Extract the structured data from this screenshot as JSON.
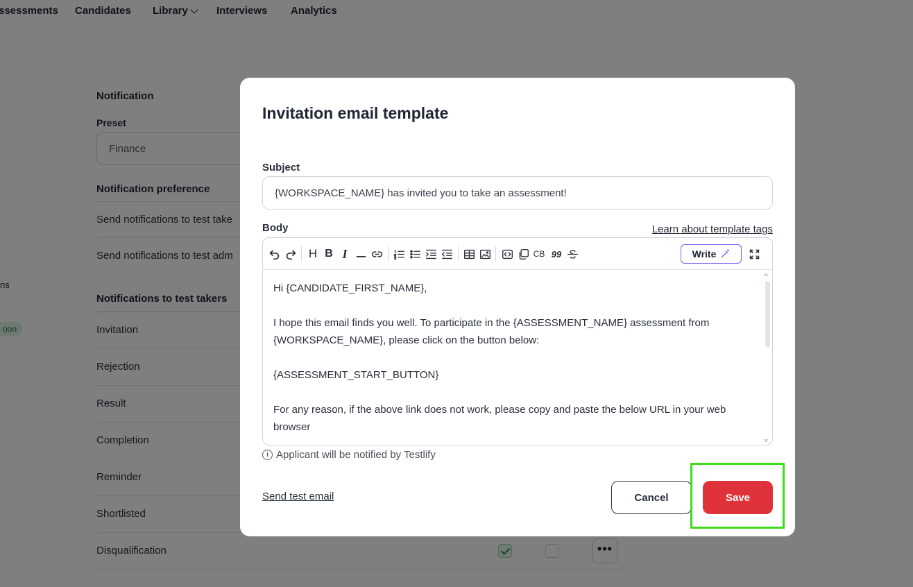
{
  "topnav": {
    "items": [
      "ssessments",
      "Candidates",
      "Library",
      "Interviews",
      "Analytics"
    ]
  },
  "background": {
    "notification_heading": "Notification",
    "preset_label": "Preset",
    "preset_value": "Finance",
    "preference_heading": "Notification preference",
    "send_to_takers": "Send notifications to test take",
    "send_to_admins": "Send notifications to test adm",
    "takers_heading": "Notifications to test takers",
    "rows": [
      "Invitation",
      "Rejection",
      "Result",
      "Completion",
      "Reminder",
      "Shortlisted",
      "Disqualification"
    ],
    "side_fragment": "ns",
    "side_badge": "oon",
    "more_label": "•••"
  },
  "modal": {
    "title": "Invitation email template",
    "subject_label": "Subject",
    "subject_value": "{WORKSPACE_NAME} has invited you to take an assessment!",
    "body_label": "Body",
    "learn_link": "Learn about template tags",
    "toolbar": {
      "heading_label": "H",
      "bold_label": "B",
      "italic_label": "I",
      "codeblock_label": "CB",
      "quote_label": "99",
      "write_label": "Write"
    },
    "body_paragraphs": [
      "Hi {CANDIDATE_FIRST_NAME},",
      "I hope this email finds you well. To participate in the {ASSESSMENT_NAME} assessment from {WORKSPACE_NAME}, please click on the button below:",
      "{ASSESSMENT_START_BUTTON}",
      "For any reason, if the above link does not work, please copy and paste the below URL in your web browser"
    ],
    "note": "Applicant will be notified by Testlify",
    "send_test_email": "Send test email",
    "cancel_label": "Cancel",
    "save_label": "Save"
  }
}
